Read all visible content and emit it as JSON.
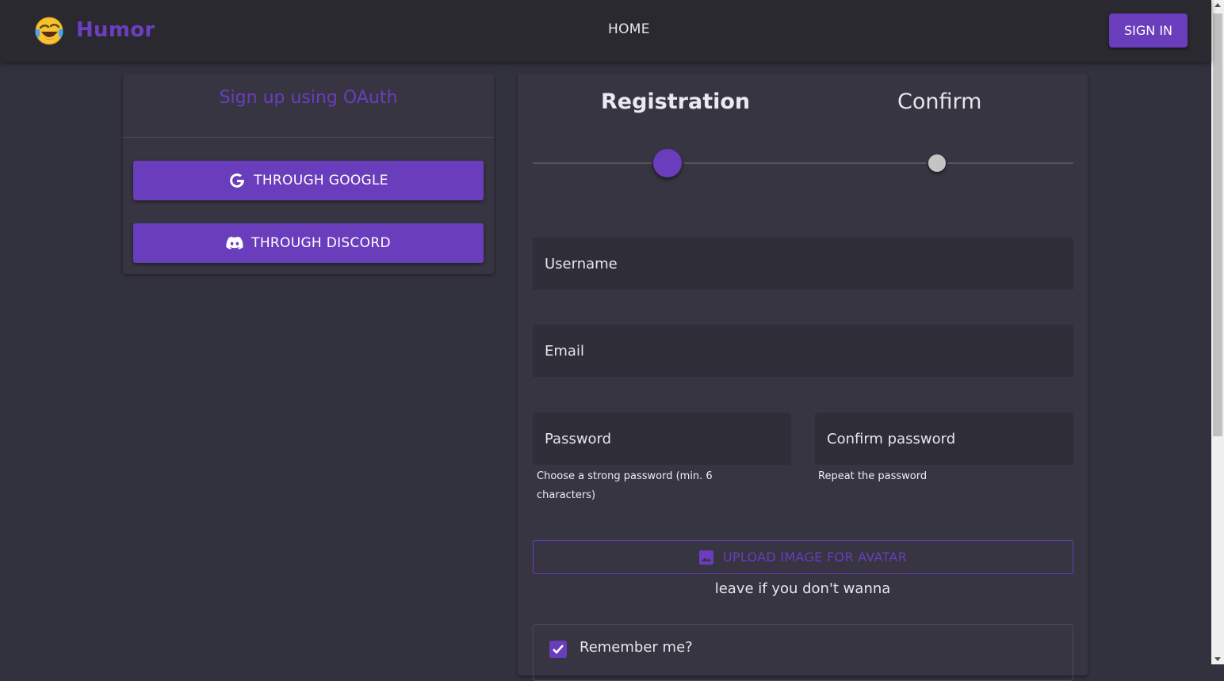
{
  "header": {
    "brand_name": "Humor",
    "brand_icon": "laughing-emoji-icon",
    "nav_home": "HOME",
    "sign_in": "SIGN IN"
  },
  "oauth": {
    "title": "Sign up using OAuth",
    "google_label": "THROUGH GOOGLE",
    "google_icon": "google-icon",
    "discord_label": "THROUGH DISCORD",
    "discord_icon": "discord-icon"
  },
  "registration": {
    "steps": [
      {
        "label": "Registration",
        "active": true
      },
      {
        "label": "Confirm",
        "active": false
      }
    ],
    "username_placeholder": "Username",
    "email_placeholder": "Email",
    "password_placeholder": "Password",
    "password_hint": "Choose a strong password (min. 6 characters)",
    "confirm_placeholder": "Confirm password",
    "confirm_hint": "Repeat the password",
    "upload_label": "UPLOAD IMAGE FOR AVATAR",
    "upload_icon": "image-icon",
    "upload_note": "leave if you don't wanna",
    "remember_label": "Remember me?",
    "remember_checked": true
  },
  "colors": {
    "accent": "#6a3dbd",
    "background": "#32313e",
    "card": "#363541",
    "topbar": "#2a292f"
  }
}
